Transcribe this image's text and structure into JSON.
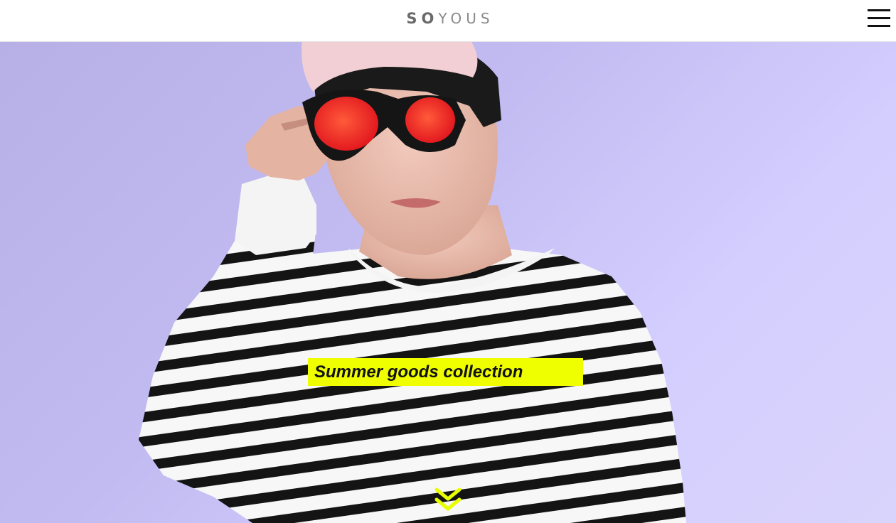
{
  "header": {
    "logo_bold": "SO",
    "logo_light": "YOUS",
    "menu_icon": "hamburger-icon"
  },
  "hero": {
    "image": "hero-image",
    "banner_text": "Summer goods collection",
    "banner_color": "#f0ff00",
    "scroll_icon": "double-chevron-down-icon",
    "scroll_icon_color": "#e8ff00",
    "background_color": "#c2bbf1"
  }
}
